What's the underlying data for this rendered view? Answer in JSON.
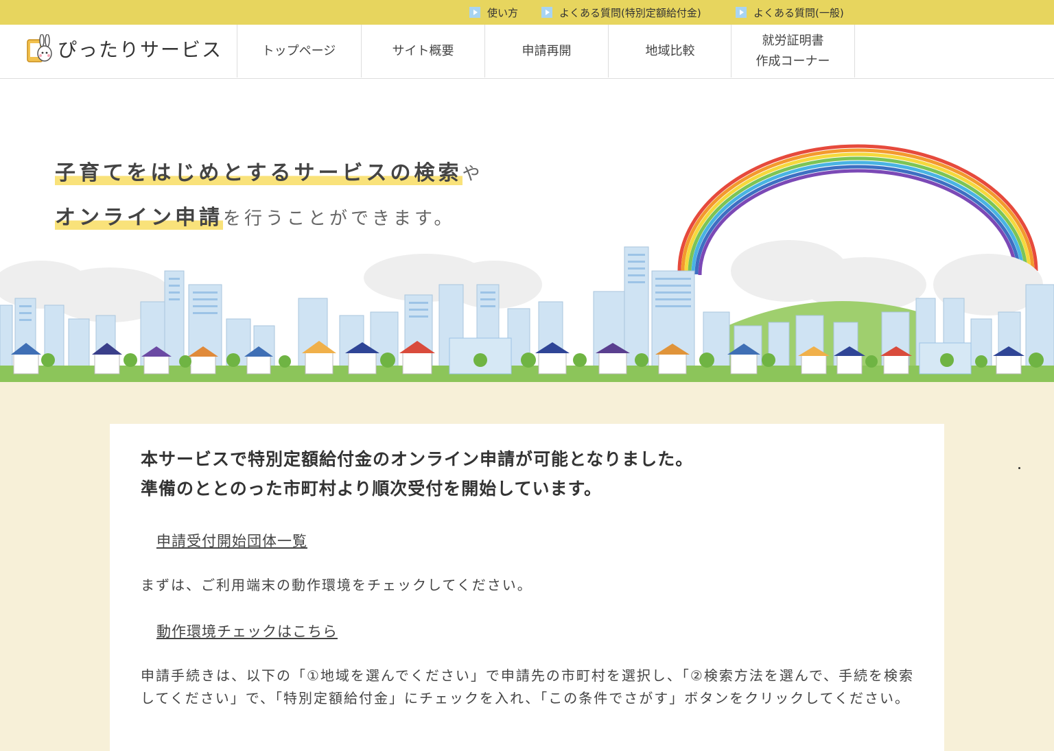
{
  "topbar": {
    "links": [
      {
        "label": "使い方"
      },
      {
        "label": "よくある質問(特別定額給付金)"
      },
      {
        "label": "よくある質問(一般)"
      }
    ]
  },
  "header": {
    "logo_text": "ぴったりサービス",
    "nav": [
      {
        "label": "トップページ"
      },
      {
        "label": "サイト概要"
      },
      {
        "label": "申請再開"
      },
      {
        "label": "地域比較"
      },
      {
        "label_line1": "就労証明書",
        "label_line2": "作成コーナー"
      }
    ]
  },
  "hero": {
    "line1_highlight": "子育てをはじめとするサービスの検索",
    "line1_rest": "や",
    "line2_highlight": "オンライン申請",
    "line2_rest": "を行うことができます。"
  },
  "main": {
    "title_line1": "本サービスで特別定額給付金のオンライン申請が可能となりました。",
    "title_line2": "準備のととのった市町村より順次受付を開始しています。",
    "link1": "申請受付開始団体一覧",
    "para1": "まずは、ご利用端末の動作環境をチェックしてください。",
    "link2": "動作環境チェックはこちら",
    "para2": "申請手続きは、以下の「①地域を選んでください」で申請先の市町村を選択し、「②検索方法を選んで、手続を検索してください」で、「特別定額給付金」にチェックを入れ、「この条件でさがす」ボタンをクリックしてください。"
  },
  "colors": {
    "topbar": "#e7d55e",
    "page_bg": "#f7f0d8",
    "highlight": "#f9e27a",
    "grass": "#8cc55a"
  }
}
